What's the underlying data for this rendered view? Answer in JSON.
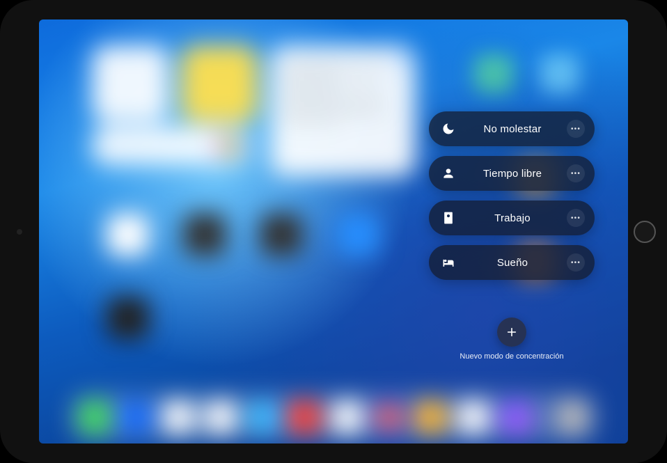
{
  "focus_modes": [
    {
      "id": "do-not-disturb",
      "label": "No molestar",
      "icon": "moon"
    },
    {
      "id": "personal",
      "label": "Tiempo libre",
      "icon": "person"
    },
    {
      "id": "work",
      "label": "Trabajo",
      "icon": "badge"
    },
    {
      "id": "sleep",
      "label": "Sueño",
      "icon": "bed"
    }
  ],
  "new_focus": {
    "label": "Nuevo modo de concentración"
  },
  "colors": {
    "pill_bg": "rgba(20,25,40,0.72)",
    "text": "#ffffff"
  }
}
